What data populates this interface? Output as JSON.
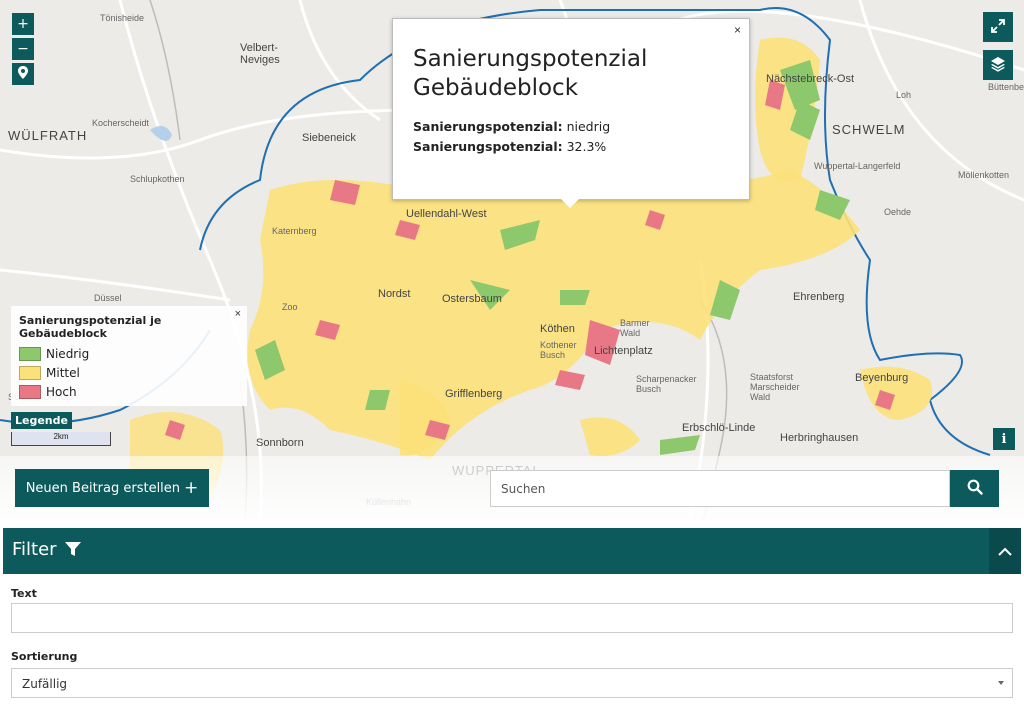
{
  "map": {
    "places": {
      "wuelfrath": "WÜLFRATH",
      "schwelm": "SCHWELM",
      "velbert_neviges": "Velbert-\nNeviges",
      "siebeneick": "Siebeneick",
      "toenisheide": "Tönisheide",
      "nachstebreck_ost": "Nächstebreck-Ost",
      "kocherscheidt": "Kocherscheidt",
      "schlupkothen": "Schlupkothen",
      "duessel": "Düssel",
      "katernberg": "Katernberg",
      "uellendahl_west": "Uellendahl-West",
      "nordstadt": "Nordst",
      "ostersbaum": "Ostersbaum",
      "koethen": "Köthen",
      "kothener_busch": "Kothener\nBusch",
      "barmer_wald": "Barmer\nWald",
      "lichtenplatz": "Lichtenplatz",
      "ehrenberg": "Ehrenberg",
      "beyenburg": "Beyenburg",
      "herbringhausen": "Herbringhausen",
      "erbschloe_linde": "Erbschlö-Linde",
      "scharpenacker_busch": "Scharpenacker\nBusch",
      "staatsforst": "Staatsforst\nMarscheider\nWald",
      "sonnborn": "Sonnborn",
      "grifflenberg": "Grifflenberg",
      "zoo": "Zoo",
      "schoeller_dornap": "Schöller-Dornap",
      "wuppertal": "WUPPERTAL",
      "kuellenhahn": "Küllenhahn",
      "loh": "Loh",
      "oehde": "Oehde",
      "moellenkotten": "Möllenkotten",
      "wuppertal_langerfeld": "Wuppertal-Langerfeld",
      "buettenberg": "Büttenbe"
    }
  },
  "popup": {
    "close": "×",
    "title_line1": "Sanierungspotenzial",
    "title_line2": "Gebäudeblock",
    "row1_label": "Sanierungspotenzial:",
    "row1_value": " niedrig",
    "row2_label": "Sanierungspotenzial:",
    "row2_value": " 32.3%"
  },
  "legend": {
    "close": "×",
    "title": "Sanierungspotenzial je Gebäudeblock",
    "items": [
      {
        "label": "Niedrig",
        "color": "#8dc86c"
      },
      {
        "label": "Mittel",
        "color": "#fce17a"
      },
      {
        "label": "Hoch",
        "color": "#e87886"
      }
    ],
    "toggle": "Legende",
    "scale": "2km"
  },
  "controls": {
    "zoom_in": "+",
    "zoom_out": "−"
  },
  "actions": {
    "new_post": "Neuen Beitrag erstellen",
    "new_post_plus": "+",
    "search_placeholder": "Suchen"
  },
  "filter": {
    "title": "Filter",
    "text_label": "Text",
    "text_value": "",
    "sort_label": "Sortierung",
    "sort_value": "Zufällig"
  },
  "colors": {
    "primary": "#0d5a5c",
    "low": "#8dc86c",
    "medium": "#fce17a",
    "high": "#e87886"
  }
}
